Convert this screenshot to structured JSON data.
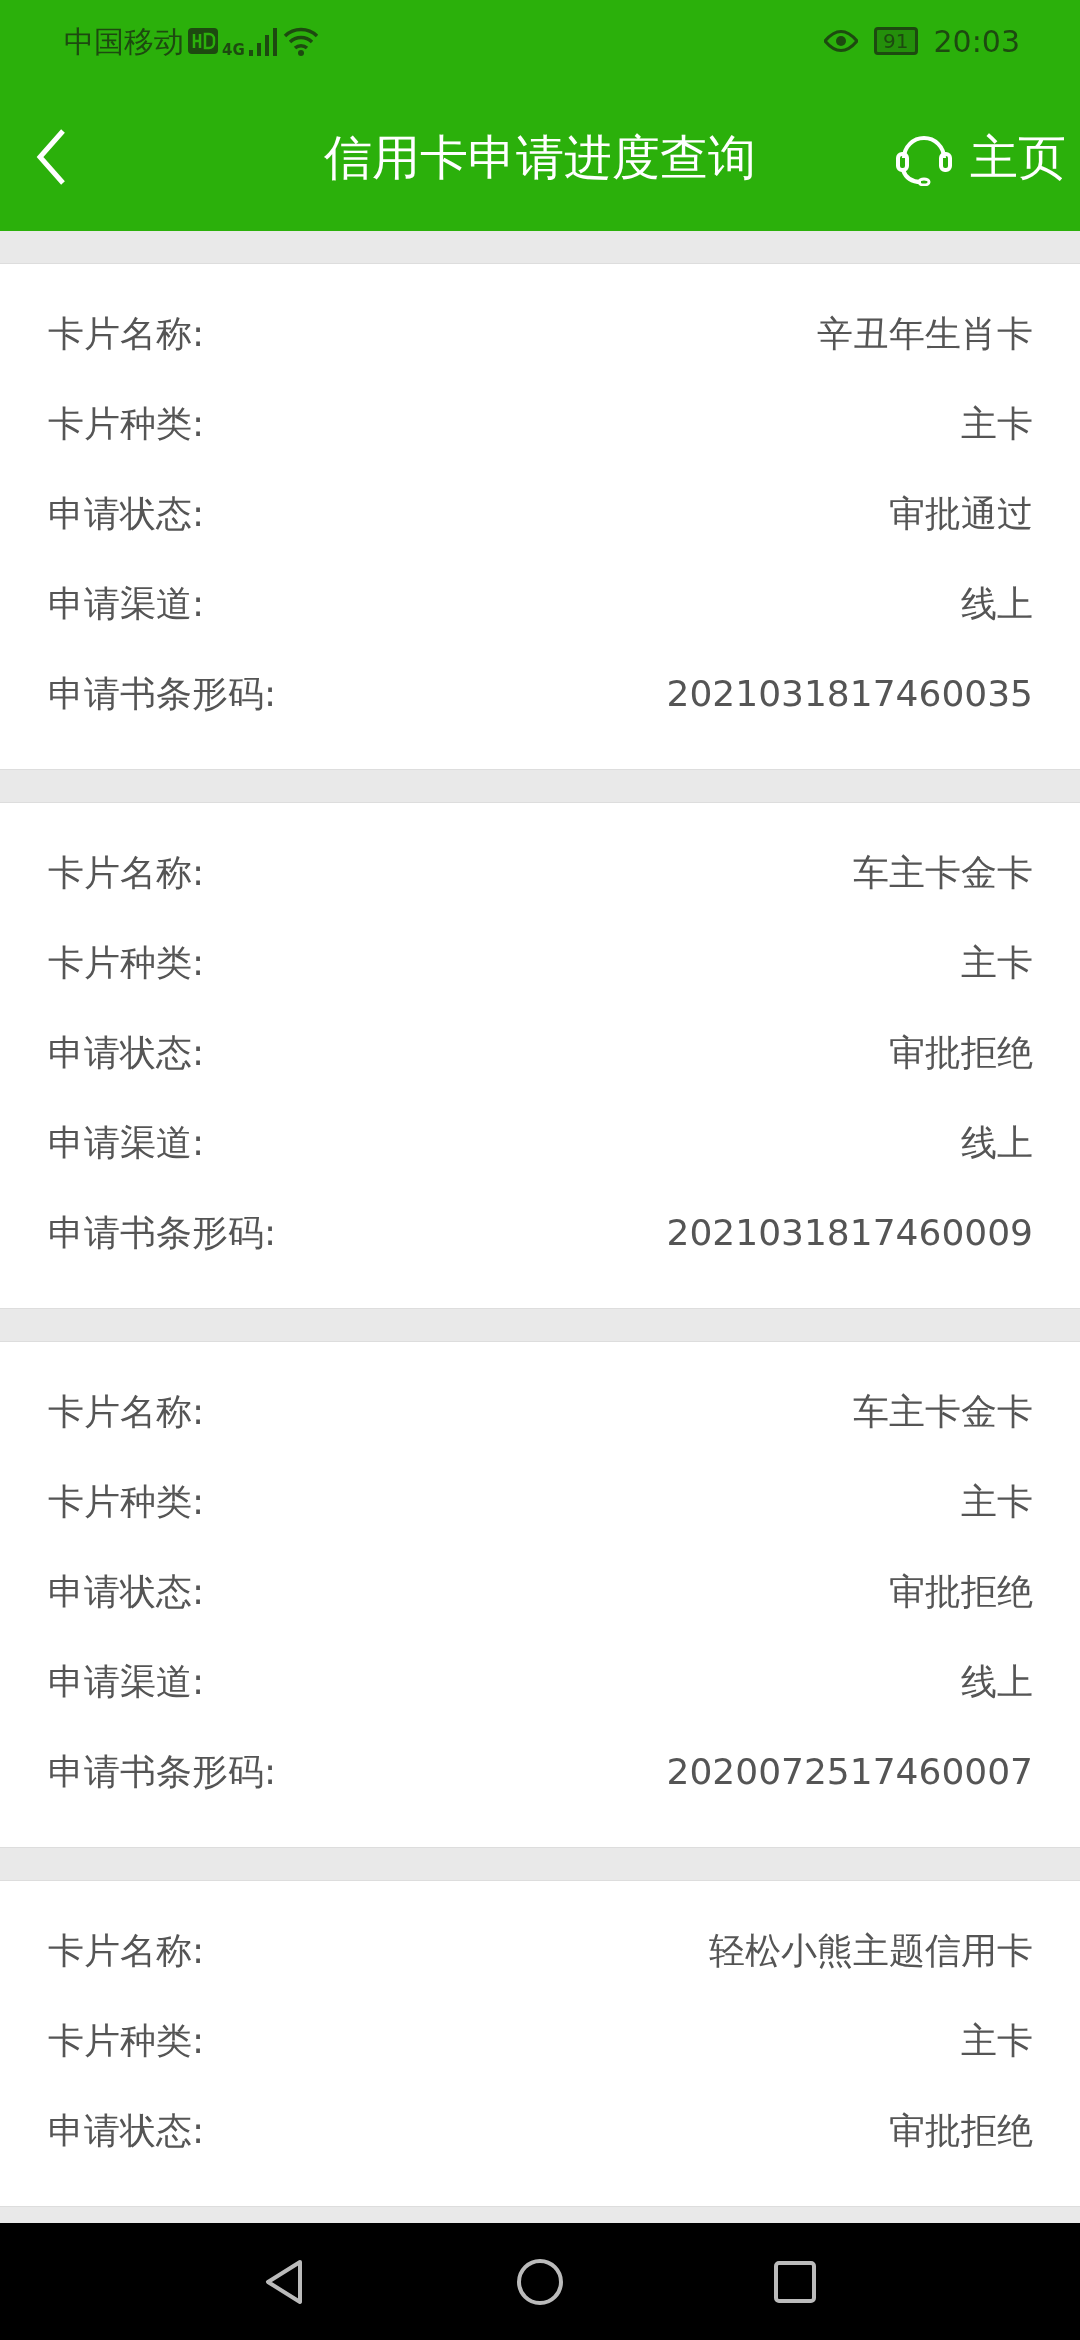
{
  "status_bar": {
    "carrier": "中国移动",
    "network": "4G",
    "battery": "91",
    "time": "20:03"
  },
  "header": {
    "title": "信用卡申请进度查询",
    "home": "主页"
  },
  "applications": [
    {
      "fields": [
        {
          "label": "卡片名称:",
          "value": "辛丑年生肖卡"
        },
        {
          "label": "卡片种类:",
          "value": "主卡"
        },
        {
          "label": "申请状态:",
          "value": "审批通过"
        },
        {
          "label": "申请渠道:",
          "value": "线上"
        },
        {
          "label": "申请书条形码:",
          "value": "2021031817460035"
        }
      ]
    },
    {
      "fields": [
        {
          "label": "卡片名称:",
          "value": "车主卡金卡"
        },
        {
          "label": "卡片种类:",
          "value": "主卡"
        },
        {
          "label": "申请状态:",
          "value": "审批拒绝"
        },
        {
          "label": "申请渠道:",
          "value": "线上"
        },
        {
          "label": "申请书条形码:",
          "value": "2021031817460009"
        }
      ]
    },
    {
      "fields": [
        {
          "label": "卡片名称:",
          "value": "车主卡金卡"
        },
        {
          "label": "卡片种类:",
          "value": "主卡"
        },
        {
          "label": "申请状态:",
          "value": "审批拒绝"
        },
        {
          "label": "申请渠道:",
          "value": "线上"
        },
        {
          "label": "申请书条形码:",
          "value": "2020072517460007"
        }
      ]
    },
    {
      "fields": [
        {
          "label": "卡片名称:",
          "value": "轻松小熊主题信用卡"
        },
        {
          "label": "卡片种类:",
          "value": "主卡"
        },
        {
          "label": "申请状态:",
          "value": "审批拒绝"
        }
      ]
    }
  ]
}
